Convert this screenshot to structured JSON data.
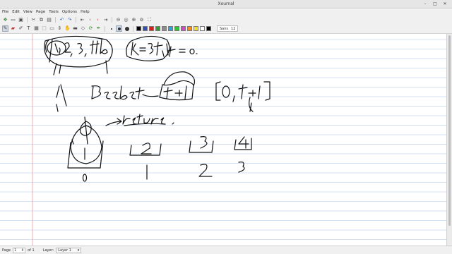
{
  "window": {
    "title": "Xournal"
  },
  "menu": [
    "File",
    "Edit",
    "View",
    "Page",
    "Tools",
    "Options",
    "Help"
  ],
  "toolbar": {
    "font_name": "Sans",
    "font_size": "12",
    "palette": [
      "#000000",
      "#2f4fbf",
      "#d02020",
      "#2f9f2f",
      "#8c8c8c",
      "#2fa3d6",
      "#36c236",
      "#d646c8",
      "#f0902a",
      "#f2df2a",
      "#ffffff"
    ],
    "selected_color": "#000000"
  },
  "status": {
    "page_label": "Page",
    "page_value": "1",
    "page_of": "of 1",
    "layer_label": "Layer:",
    "layer_value": "Layer 1"
  },
  "page_style": {
    "rule_color": "#a9c3e8",
    "margin_color": "#ef9aa8"
  }
}
